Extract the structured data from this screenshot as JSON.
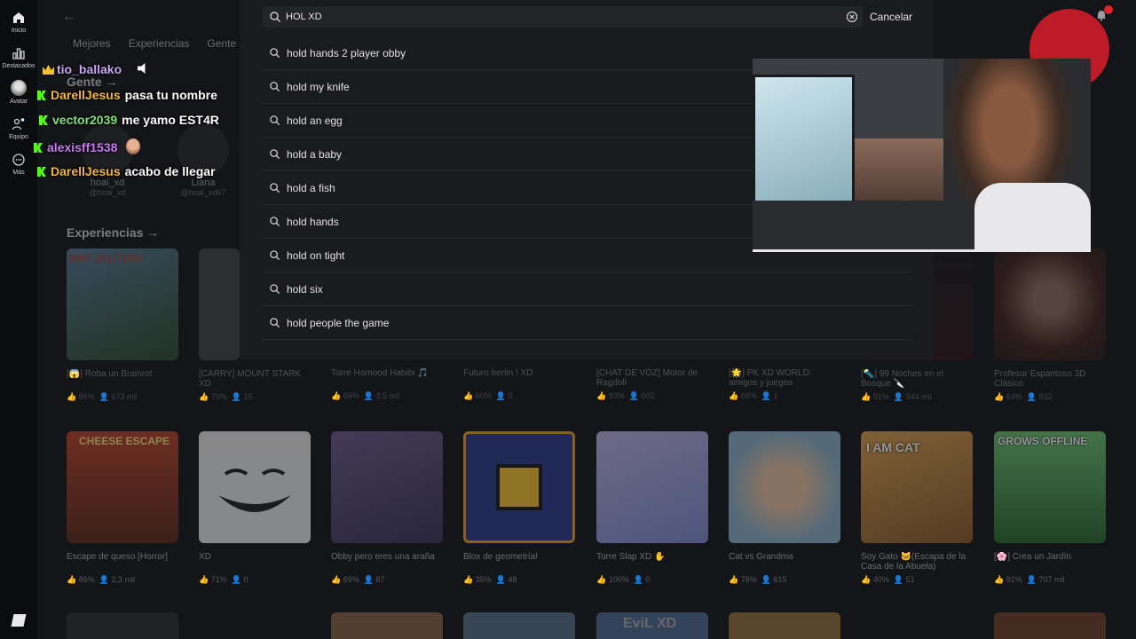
{
  "rail": {
    "items": [
      {
        "label": "Inicio",
        "icon": "home-icon"
      },
      {
        "label": "Destacados",
        "icon": "chart-icon"
      },
      {
        "label": "Avatar",
        "icon": "avatar-icon"
      },
      {
        "label": "Equipo",
        "icon": "group-icon"
      },
      {
        "label": "Más",
        "icon": "more-icon"
      }
    ]
  },
  "background": {
    "tabs": [
      "Mejores",
      "Experiencias",
      "Gente"
    ],
    "people_heading": "Gente →",
    "people": [
      {
        "name": "hoal_xd",
        "username": "@hoal_xd"
      },
      {
        "name": "Liana",
        "username": "@hoal_xd67"
      }
    ],
    "experiences_heading": "Experiencias →",
    "row1": [
      {
        "title": "[😱] Roba un Brainrot",
        "rating": "86%",
        "players": "673 mil"
      },
      {
        "title": "[CARRY] MOUNT STARK XD",
        "rating": "76%",
        "players": "15"
      },
      {
        "title": "Torre Hamood Habibi 🎵",
        "rating": "95%",
        "players": "3,5 mil"
      },
      {
        "title": "Futuro berlin ! XD",
        "rating": "60%",
        "players": "0"
      },
      {
        "title": "[CHAT DE VOZ] Motor de Ragdoll",
        "rating": "93%",
        "players": "602"
      },
      {
        "title": "[🌟] PK XD WORLD: amigos y juegos",
        "rating": "68%",
        "players": "1"
      },
      {
        "title": "[🔦] 99 Noches en el Bosque 🔪",
        "rating": "91%",
        "players": "944 mil"
      },
      {
        "title": "Profesor Espantoso 3D Clásico",
        "rating": "64%",
        "players": "832"
      }
    ],
    "row1_overlay_text": "$997,213,719/s",
    "row2": [
      {
        "title": "Escape de queso [Horror]",
        "rating": "86%",
        "players": "2,3 mil",
        "overlay": "CHEESE ESCAPE"
      },
      {
        "title": "XD",
        "rating": "71%",
        "players": "0",
        "overlay": ""
      },
      {
        "title": "Obby pero eres una araña",
        "rating": "69%",
        "players": "87",
        "overlay": ""
      },
      {
        "title": "Blox de geometría!",
        "rating": "35%",
        "players": "48",
        "overlay": ""
      },
      {
        "title": "Torre Slap XD ✋",
        "rating": "100%",
        "players": "0",
        "overlay": ""
      },
      {
        "title": "Cat vs Grandma",
        "rating": "78%",
        "players": "615",
        "overlay": ""
      },
      {
        "title": "Soy Gato 🐱(Escapa de la Casa de la Abuela)",
        "rating": "40%",
        "players": "51",
        "overlay": "I AM CAT"
      },
      {
        "title": "[🌸] Crea un Jardín",
        "rating": "91%",
        "players": "707 mil",
        "overlay": "GROWS OFFLINE"
      }
    ],
    "row3_overlay": "EviL XD"
  },
  "search": {
    "value": "HOL XD",
    "cancel_label": "Cancelar",
    "suggestions": [
      "hold hands 2 player obby",
      "hold my knife",
      "hold an egg",
      "hold a baby",
      "hold a fish",
      "hold hands",
      "hold on tight",
      "hold six",
      "hold people the game"
    ]
  },
  "chat": [
    {
      "user": "tio_ballako",
      "color": "#c7a8f0",
      "badge": "crown",
      "message": ""
    },
    {
      "user": "DarellJesus",
      "color": "#f2b73c",
      "badge": "kick",
      "message": "pasa tu nombre"
    },
    {
      "user": "vector2039",
      "color": "#7fe07a",
      "badge": "kick",
      "message": "me yamo EST4R"
    },
    {
      "user": "alexisff1538",
      "color": "#c77af0",
      "badge": "kick",
      "message": ""
    },
    {
      "user": "DarellJesus",
      "color": "#f2b73c",
      "badge": "kick",
      "message": "acabo de llegar"
    }
  ],
  "colors": {
    "accent_red": "#d01c2a",
    "kick_green": "#53fc18"
  }
}
